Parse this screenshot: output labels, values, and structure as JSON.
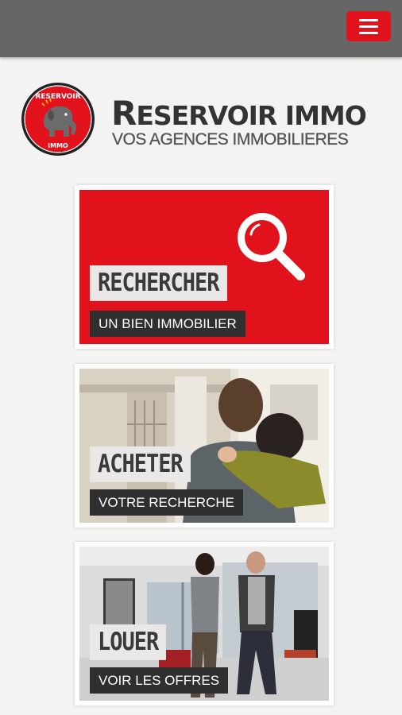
{
  "header": {
    "menu_icon": "hamburger-icon"
  },
  "brand": {
    "title_big": "R",
    "title_rest": "ESERVOIR IMMO",
    "subtitle": "VOS AGENCES IMMOBILIERES",
    "logo_top_text": "RESERVOIR",
    "logo_bottom_text": "IMMO"
  },
  "cards": [
    {
      "title": "RECHERCHER",
      "subtitle": "UN BIEN IMMOBILIER"
    },
    {
      "title": "ACHETER",
      "subtitle": "VOTRE RECHERCHE"
    },
    {
      "title": "LOUER",
      "subtitle": "VOIR LES OFFRES"
    }
  ],
  "colors": {
    "accent": "#e2121d",
    "topbar": "#666666",
    "label_dark": "#2f2f30"
  }
}
